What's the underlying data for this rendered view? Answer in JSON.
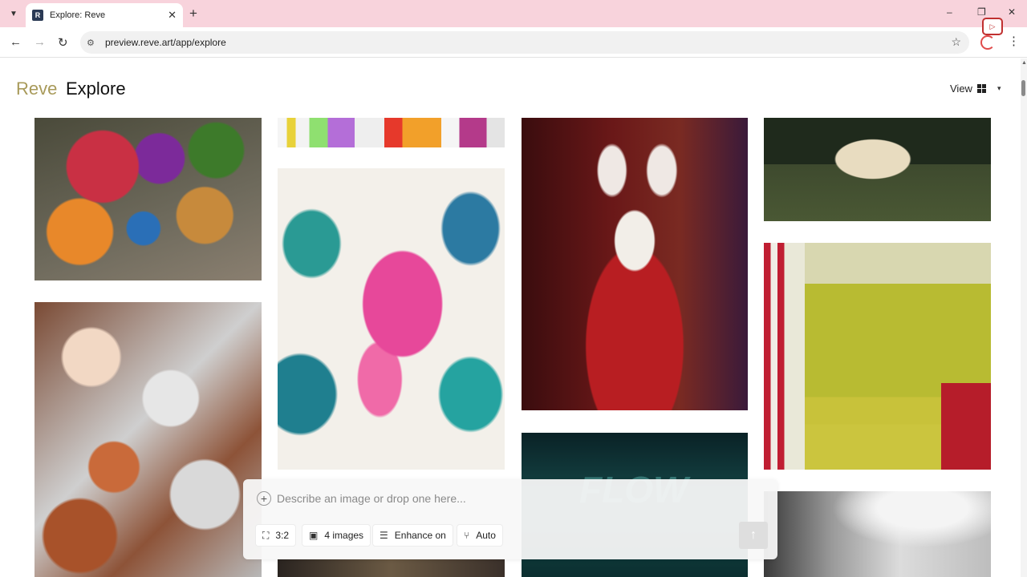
{
  "browser": {
    "tab_title": "Explore: Reve",
    "favicon_letter": "R",
    "url": "preview.reve.art/app/explore",
    "icons": {
      "tab_list": "chevron-down-icon",
      "close_tab": "close-icon",
      "new_tab": "plus-icon",
      "back": "arrow-left-icon",
      "forward": "arrow-right-icon",
      "reload": "reload-icon",
      "site_info": "tune-icon",
      "bookmark": "star-icon",
      "menu": "more-vertical-icon"
    },
    "window_controls": {
      "minimize": "–",
      "restore": "❐",
      "close": "✕"
    }
  },
  "header": {
    "brand": "Reve",
    "title": "Explore",
    "view_label": "View"
  },
  "gallery": {
    "flow_text": "FLOW"
  },
  "prompt": {
    "placeholder": "Describe an image or drop one here...",
    "chips": {
      "aspect": "3:2",
      "count": "4 images",
      "enhance": "Enhance on",
      "model": "Auto"
    }
  },
  "colors": {
    "tabbar_bg": "#f8d3dc",
    "brand": "#a89a5a"
  }
}
